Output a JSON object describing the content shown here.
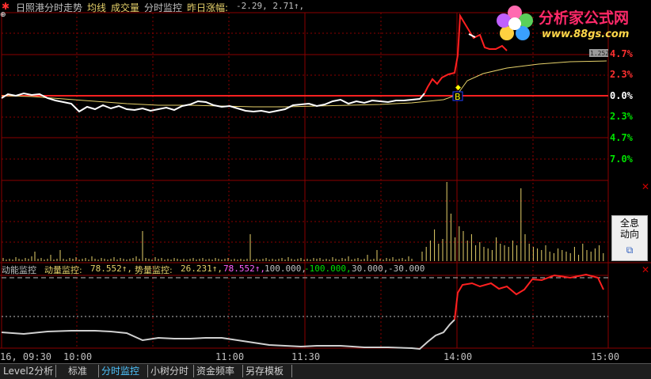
{
  "top_bar": {
    "title": "日照港分时走势",
    "avg_label": "均线",
    "volume_label": "成交量",
    "monitor_label": "分时监控",
    "range_label": "昨日涨幅:",
    "range_value": "-2.29, 2.71↑,"
  },
  "price_axis": {
    "up_labels": [
      "4.7%",
      "2.3%"
    ],
    "zero_label": "0.0%",
    "down_labels": [
      "2.3%",
      "4.7%",
      "7.0%"
    ]
  },
  "marker": {
    "buy_label": "B",
    "badge": "1.252"
  },
  "indicator_bar": {
    "name": "动能监控",
    "momentum_label": "动量监控:",
    "momentum_value": "78.552↑,",
    "trend_label": "势量监控:",
    "trend_value": "26.231↑,",
    "pink_value": "78.552↑,",
    "level1": "100.000,",
    "level2": "-100.000,",
    "level3": "30.000,",
    "level4": "-30.000"
  },
  "time_axis": [
    "16, 09:30",
    "10:00",
    "11:00",
    "11:30",
    "14:00",
    "15:00"
  ],
  "tabs": [
    {
      "label": "Level2分析",
      "active": false
    },
    {
      "label": "标准",
      "active": false
    },
    {
      "label": "分时监控",
      "active": true
    },
    {
      "label": "小树分时",
      "active": false
    },
    {
      "label": "资金频率",
      "active": false
    },
    {
      "label": "另存模板",
      "active": false
    }
  ],
  "side_button": {
    "line1": "全息",
    "line2": "动向"
  },
  "logo": {
    "name": "分析家公式网",
    "url": "www.88gs.com"
  },
  "colors": {
    "grid": "#8b0000",
    "price_line": "#ffffff",
    "avg_line": "#e6d16a",
    "up": "#ff3030",
    "down": "#00e000",
    "volume": "#e6d16a"
  },
  "chart_data": {
    "type": "line",
    "title": "日照港分时走势",
    "x": [
      "09:30",
      "10:00",
      "11:00",
      "11:30",
      "14:00",
      "15:00"
    ],
    "ylim": [
      -7.0,
      7.0
    ],
    "y_ticks": [
      7.0,
      4.7,
      2.3,
      0.0,
      -2.3,
      -4.7,
      -7.0
    ],
    "series": [
      {
        "name": "分时",
        "values": [
          0.0,
          0.2,
          -0.5,
          -0.4,
          -0.6,
          -0.3,
          0.0,
          0.2,
          0.3,
          0.0,
          8.0,
          5.0,
          4.6
        ]
      },
      {
        "name": "均线",
        "values": [
          0.0,
          0.0,
          -0.3,
          -0.3,
          -0.4,
          -0.4,
          -0.3,
          -0.3,
          -0.2,
          0.0,
          2.3,
          3.0,
          3.4
        ]
      }
    ]
  }
}
